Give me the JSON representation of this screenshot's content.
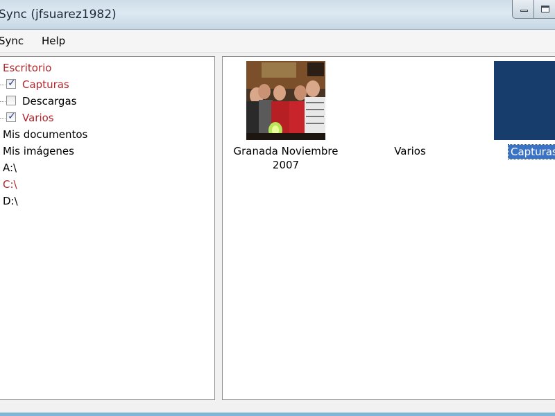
{
  "window": {
    "title": "Sync (jfsuarez1982)"
  },
  "menu": {
    "sync": "Sync",
    "help": "Help"
  },
  "tree": {
    "items": [
      {
        "label": "Escritorio",
        "color": "#b1262b"
      },
      {
        "label": "Capturas",
        "checked": true,
        "color": "#b1262b"
      },
      {
        "label": "Descargas",
        "checked": false
      },
      {
        "label": "Varios",
        "checked": true,
        "color": "#b1262b"
      },
      {
        "label": "Mis documentos"
      },
      {
        "label": "Mis imágenes"
      },
      {
        "label": "A:\\"
      },
      {
        "label": "C:\\",
        "color": "#b1262b"
      },
      {
        "label": "D:\\"
      }
    ]
  },
  "content": {
    "items": [
      {
        "label": "Granada Noviembre 2007",
        "thumbnail": "group-photo"
      },
      {
        "label": "Varios",
        "thumbnail": "none"
      },
      {
        "label": "Capturas",
        "thumbnail": "blue-square",
        "selected": true
      }
    ]
  },
  "colors": {
    "selection": "#3a73c6",
    "highlight_text": "#b1262b",
    "thumbnail_blue": "#163d6b"
  }
}
